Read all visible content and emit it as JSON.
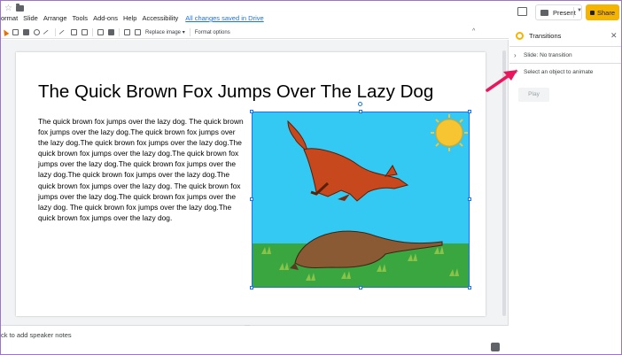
{
  "menu": {
    "items": [
      "ormat",
      "Slide",
      "Arrange",
      "Tools",
      "Add-ons",
      "Help",
      "Accessibility"
    ],
    "saved_status": "All changes saved in Drive"
  },
  "header": {
    "present_label": "Present",
    "share_label": "Share"
  },
  "toolbar": {
    "replace_image": "Replace image ▾",
    "format_options": "Format options"
  },
  "slide": {
    "title": "The Quick Brown Fox Jumps Over The Lazy Dog",
    "body": "The quick brown fox jumps over the lazy dog. The quick brown fox jumps over the lazy dog.The quick brown fox jumps over the lazy dog.The quick brown fox jumps over the lazy dog.The quick brown fox jumps over the lazy dog.The quick brown fox jumps over the lazy dog.The quick brown fox jumps over the lazy dog.The quick brown fox jumps over the lazy dog.The quick brown fox jumps over the lazy dog. The quick brown fox jumps over the lazy dog.The quick brown fox jumps over the lazy dog. The quick brown fox jumps over the lazy dog.The quick brown fox jumps over the lazy dog."
  },
  "notes": {
    "placeholder": "ck to add speaker notes"
  },
  "panel": {
    "title": "Transitions",
    "slide_transition": "Slide: No transition",
    "select_object": "Select an object to animate",
    "play_label": "Play"
  },
  "colors": {
    "accent_blue": "#1a73e8",
    "share_yellow": "#f4b400",
    "arrow_pink": "#e8175d",
    "sky": "#33c9f2",
    "grass": "#3aa63f",
    "fox": "#c8481d",
    "sun": "#f7c531"
  },
  "icons": [
    "star-icon",
    "folder-icon",
    "comment-icon",
    "present-icon",
    "lock-icon",
    "transitions-icon",
    "close-icon",
    "chevron-right-icon",
    "plus-icon",
    "add-icon"
  ]
}
